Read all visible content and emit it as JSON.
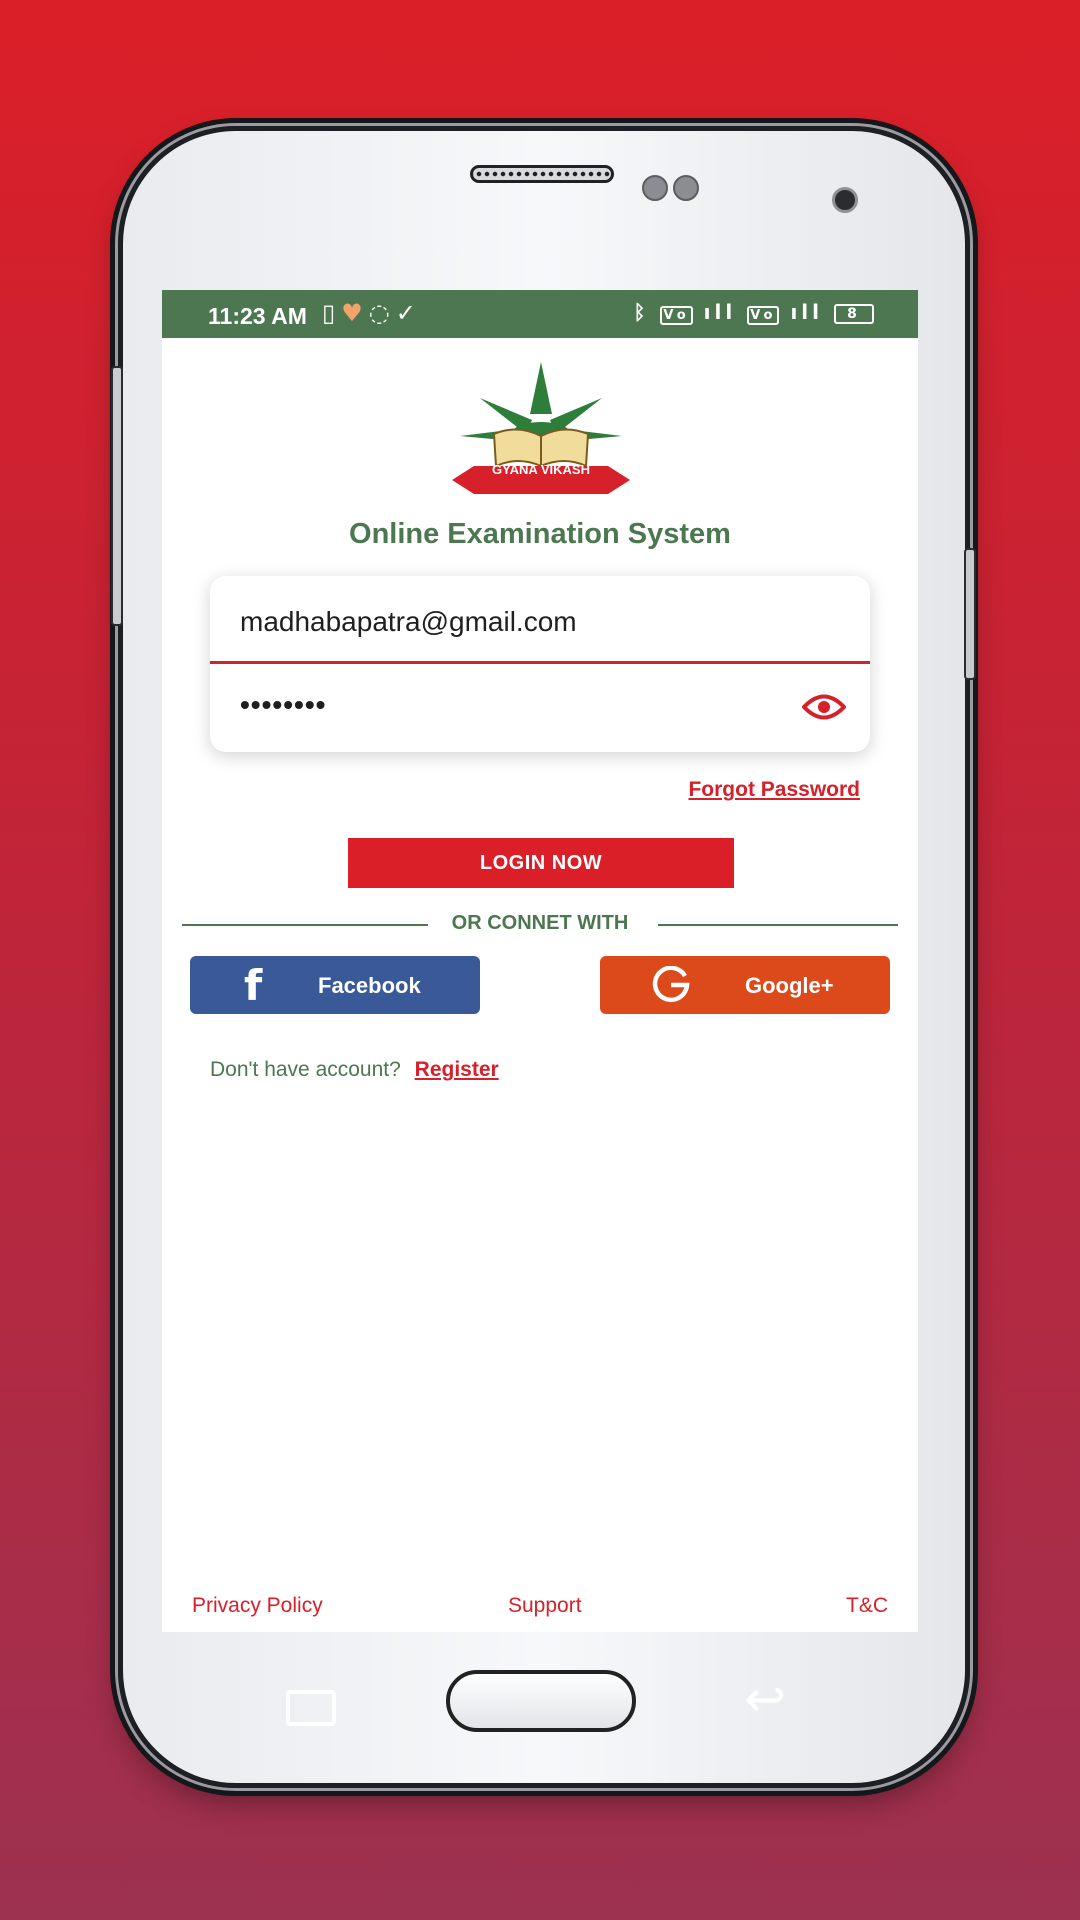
{
  "statusbar": {
    "time": "11:23 AM",
    "icons_left": [
      "vibrate-icon",
      "heart-icon",
      "whatsapp-icon",
      "check-icon"
    ],
    "icons_right": [
      "bluetooth-icon",
      "volte-icon",
      "signal-icon",
      "volte-icon",
      "signal-icon",
      "battery-icon"
    ],
    "battery_level": "8"
  },
  "logo": {
    "text": "GYANA VIKASH"
  },
  "app": {
    "title": "Online Examination System"
  },
  "login": {
    "email_value": "madhabapatra@gmail.com",
    "password_value": "••••••••",
    "forgot_label": "Forgot Password",
    "button_label": "LOGIN NOW"
  },
  "social": {
    "divider_text": "OR CONNET WITH",
    "facebook_label": "Facebook",
    "google_label": "Google+"
  },
  "register": {
    "prompt": "Don't have account?",
    "link_label": "Register"
  },
  "footer": {
    "privacy": "Privacy Policy",
    "support": "Support",
    "tnc": "T&C"
  },
  "colors": {
    "background_top": "#db1f28",
    "background_bottom": "#9c3150",
    "statusbar": "#4c7750",
    "brand_green": "#4c7750",
    "brand_red": "#db1f28",
    "facebook": "#3a5999",
    "google": "#dc4a1b"
  }
}
